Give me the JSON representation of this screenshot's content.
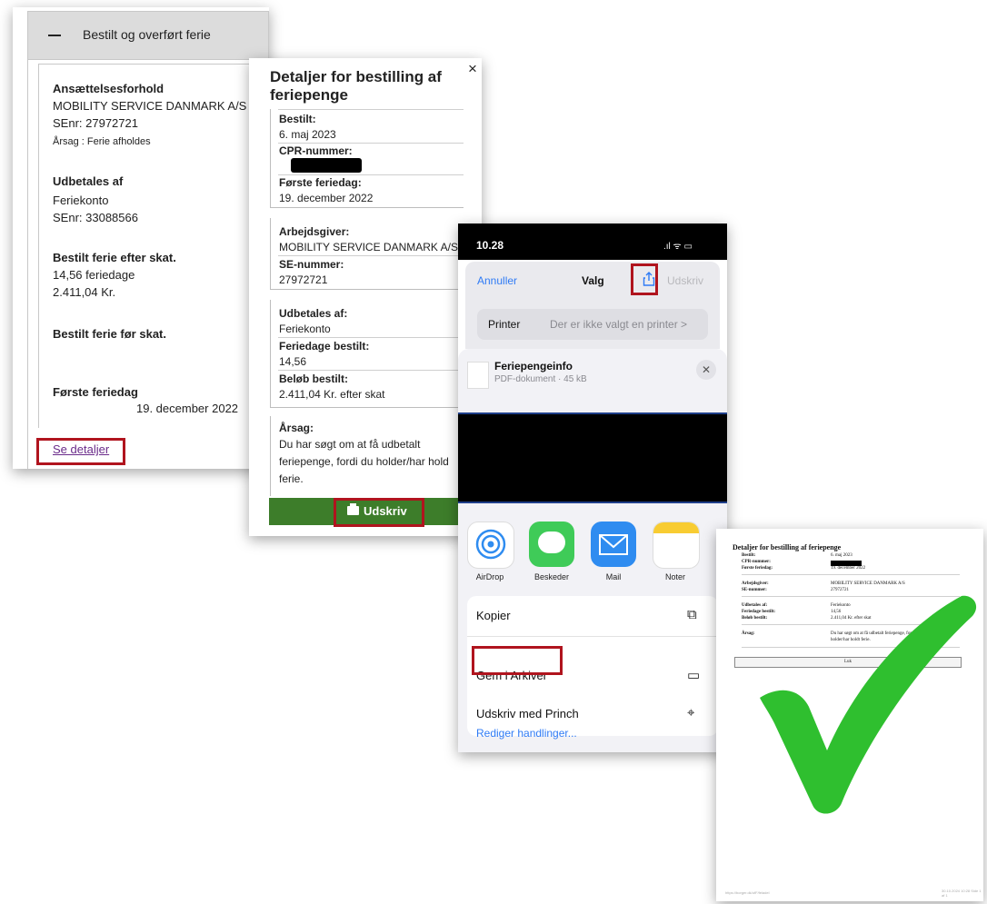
{
  "panel1": {
    "accordion_title": "Bestilt og overført ferie",
    "employment_label": "Ansættelsesforhold",
    "employer_name": "MOBILITY SERVICE DANMARK A/S",
    "employer_senr": "SEnr: 27972721",
    "reason": "Årsag : Ferie afholdes",
    "payer_label": "Udbetales af",
    "payer_name": "Feriekonto",
    "payer_senr": "SEnr: 33088566",
    "after_tax_label": "Bestilt ferie efter skat.",
    "after_tax_days": "14,56 feriedage",
    "after_tax_amount": "2.411,04 Kr.",
    "before_tax_label": "Bestilt ferie før skat.",
    "first_day_label": "Første feriedag",
    "first_day_value": "19. december 2022",
    "details_link": "Se detaljer"
  },
  "panel2": {
    "title": "Detaljer for bestilling af feriepenge",
    "close": "×",
    "ordered_label": "Bestilt:",
    "ordered_value": "6. maj 2023",
    "cpr_label": "CPR-nummer:",
    "first_day_label": "Første feriedag:",
    "first_day_value": "19. december 2022",
    "employer_label": "Arbejdsgiver:",
    "employer_value": "MOBILITY SERVICE DANMARK A/S",
    "se_label": "SE-nummer:",
    "se_value": "27972721",
    "payer_label": "Udbetales af:",
    "payer_value": "Feriekonto",
    "days_label": "Feriedage bestilt:",
    "days_value": "14,56",
    "amount_label": "Beløb bestilt:",
    "amount_value": "2.411,04 Kr. efter skat",
    "reason_label": "Årsag:",
    "reason_line1": "Du har søgt om at få udbetalt",
    "reason_line2": "feriepenge, fordi du holder/har hold",
    "reason_line3": "ferie.",
    "print_button": "Udskriv"
  },
  "panel3": {
    "time": "10.28",
    "status_icons": ".ıl ᯤ ▭",
    "cancel": "Annuller",
    "options": "Valg",
    "print": "Udskriv",
    "printer_label": "Printer",
    "printer_value": "Der er ikke valgt en printer >",
    "doc_name": "Feriepengeinfo",
    "doc_sub": "PDF-dokument · 45 kB",
    "close": "✕",
    "apps": [
      "AirDrop",
      "Beskeder",
      "Mail",
      "Noter"
    ],
    "actions": [
      "Kopier",
      "Gem i Arkiver",
      "Udskriv med Princh"
    ],
    "edit_actions": "Rediger handlinger..."
  },
  "panel4": {
    "heading": "Detaljer for bestilling af feriepenge",
    "rows": [
      {
        "label": "Bestilt:",
        "value": "6. maj 2023"
      },
      {
        "label": "CPR-nummer:",
        "value": ""
      },
      {
        "label": "Første feriedag:",
        "value": "19. december 2022"
      },
      {
        "label": "Arbejdsgiver:",
        "value": "MOBILITY SERVICE DANMARK A/S"
      },
      {
        "label": "SE-nummer:",
        "value": "27972721"
      },
      {
        "label": "Udbetales af:",
        "value": "Feriekonto"
      },
      {
        "label": "Feriedage bestilt:",
        "value": "14,56"
      },
      {
        "label": "Beløb bestilt:",
        "value": "2.411,04 Kr. efter skat"
      },
      {
        "label": "Årsag:",
        "value": "Du har søgt om at få udbetalt feriepenge, fordi"
      },
      {
        "label": "",
        "value": "holder/har holdt ferie."
      }
    ],
    "close_button": "Luk",
    "footer_left": "https://borger.dk/ufF/feladel",
    "footer_right": "30.10.2024 10:28 Side 1 af 1"
  },
  "colors": {
    "highlight": "#b0141e",
    "print_green": "#3d7d2a",
    "ios_blue": "#2f7bf5",
    "check_green": "#2fbf2f"
  }
}
